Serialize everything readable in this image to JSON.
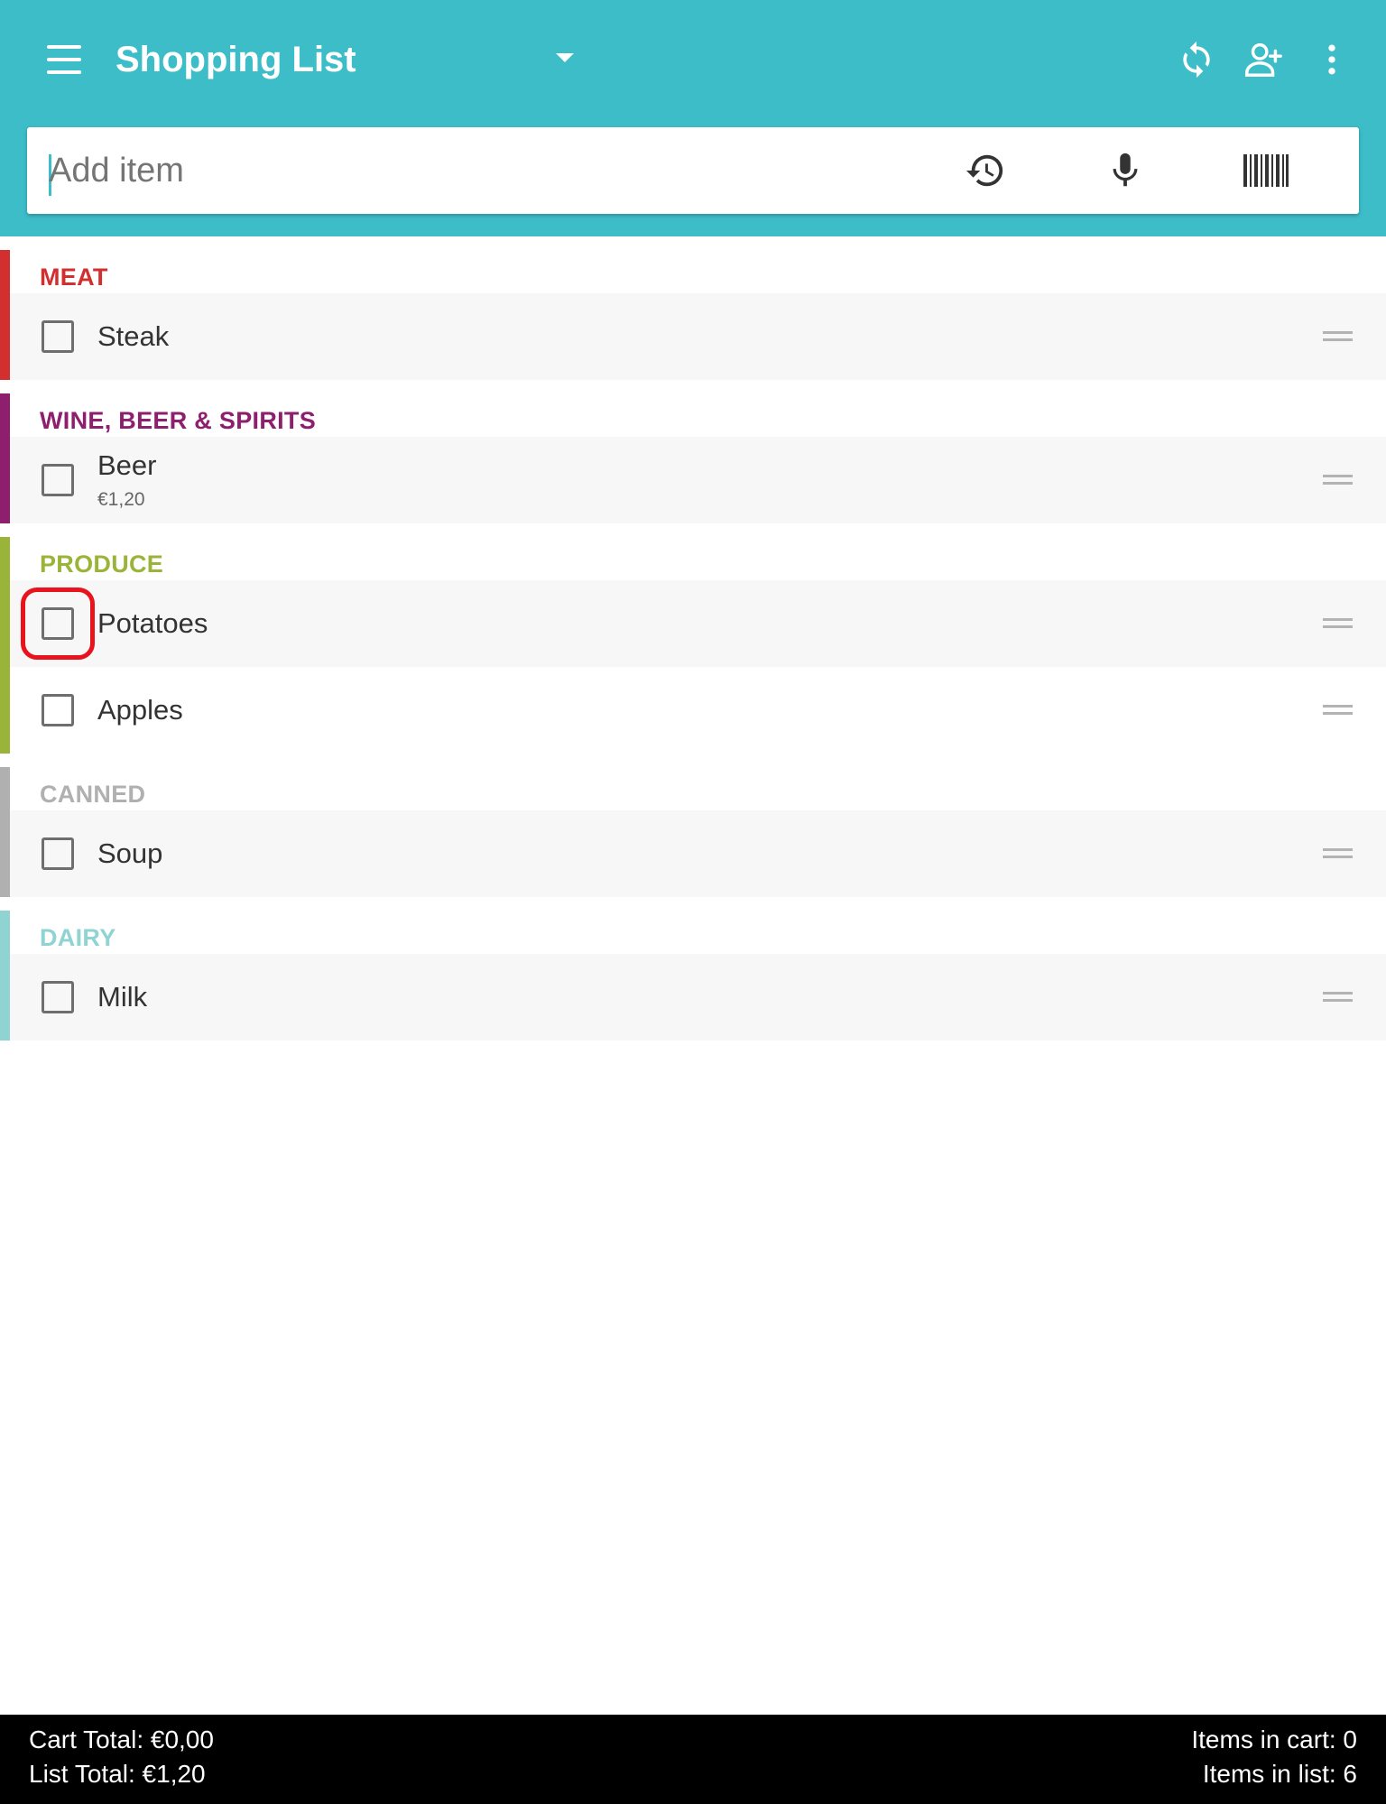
{
  "appbar": {
    "title": "Shopping List",
    "icons": [
      "menu-icon",
      "dropdown-arrow-icon",
      "sync-icon",
      "share-person-add-icon",
      "more-vert-icon"
    ]
  },
  "search": {
    "placeholder": "Add item",
    "value": "",
    "icons": [
      "history-icon",
      "microphone-icon",
      "barcode-icon"
    ]
  },
  "colors": {
    "appbar": "#3dbdc8",
    "meat": "#d32f2f",
    "wine": "#8e1f6e",
    "produce": "#9ab43a",
    "canned": "#b0b0b0",
    "dairy": "#8fd3d3",
    "highlight": "#e8131c"
  },
  "categories": [
    {
      "name": "MEAT",
      "items": [
        {
          "name": "Steak"
        }
      ]
    },
    {
      "name": "WINE, BEER & SPIRITS",
      "items": [
        {
          "name": "Beer",
          "price": "€1,20"
        }
      ]
    },
    {
      "name": "PRODUCE",
      "items": [
        {
          "name": "Potatoes"
        },
        {
          "name": "Apples"
        }
      ]
    },
    {
      "name": "CANNED",
      "items": [
        {
          "name": "Soup"
        }
      ]
    },
    {
      "name": "DAIRY",
      "items": [
        {
          "name": "Milk"
        }
      ]
    }
  ],
  "footer": {
    "cart_total": "Cart Total: €0,00",
    "list_total": "List Total: €1,20",
    "items_in_cart": "Items in cart: 0",
    "items_in_list": "Items in list: 6"
  }
}
